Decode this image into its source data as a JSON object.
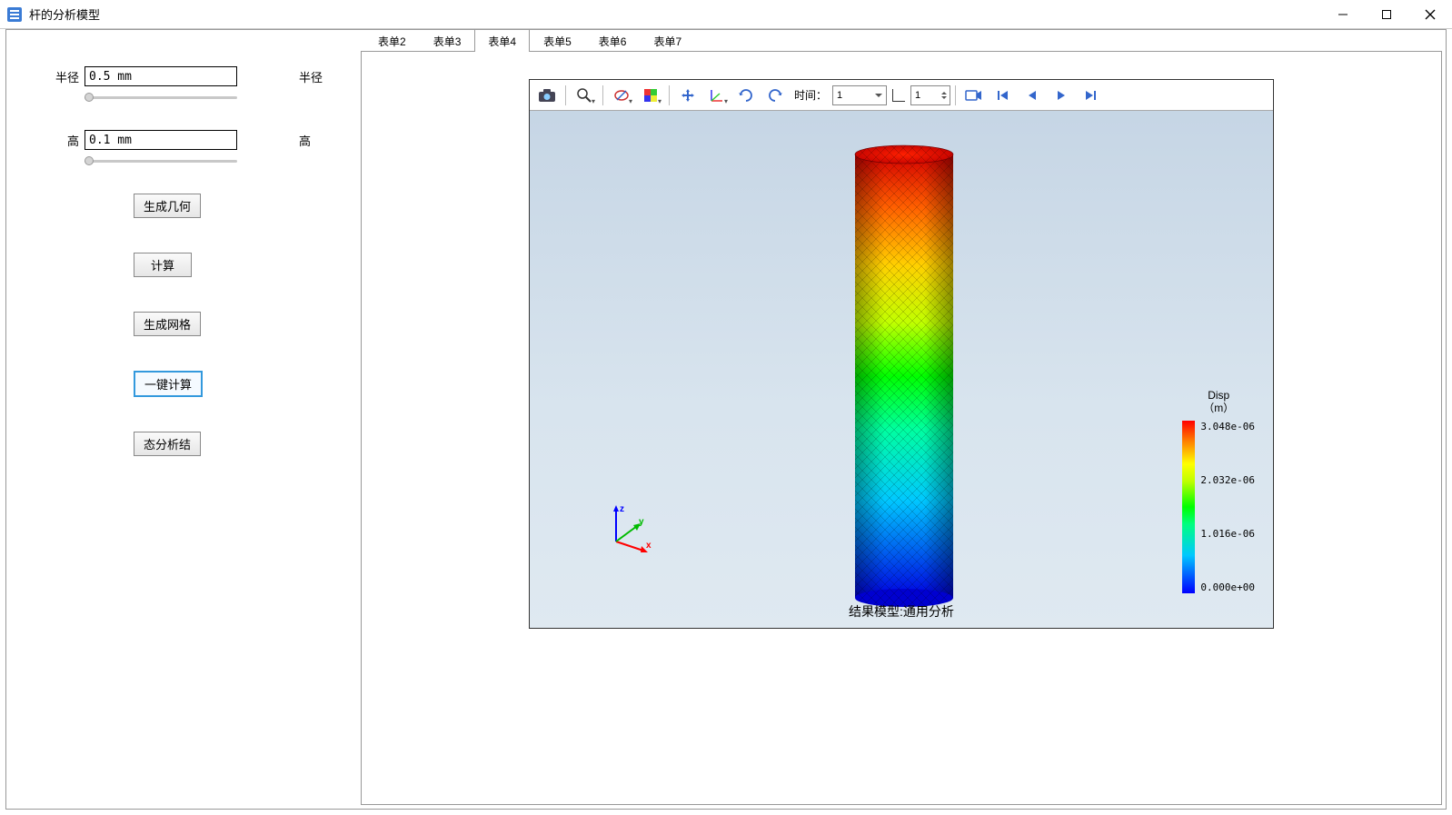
{
  "window": {
    "title": "杆的分析模型"
  },
  "sidebar": {
    "radius_label": "半径",
    "radius_value": "0.5 mm",
    "radius_label_right": "半径",
    "height_label": "高",
    "height_value": "0.1 mm",
    "height_label_right": "高",
    "buttons": {
      "gen_geom": "生成几何",
      "compute": "计算",
      "gen_mesh": "生成网格",
      "one_click": "一键计算",
      "modal_result": "态分析结"
    }
  },
  "tabs": [
    "表单2",
    "表单3",
    "表单4",
    "表单5",
    "表单6",
    "表单7"
  ],
  "active_tab_index": 2,
  "toolbar": {
    "time_label": "时间：",
    "time_combo_value": "1",
    "time_spin_value": "1"
  },
  "viewer": {
    "caption": "结果模型:通用分析"
  },
  "legend": {
    "title1": "Disp",
    "title2": "（m）",
    "ticks": [
      "3.048e-06",
      "2.032e-06",
      "1.016e-06",
      "0.000e+00"
    ]
  },
  "chart_data": {
    "type": "heatmap",
    "title": "Disp (m)",
    "field": "displacement magnitude",
    "geometry": "cylinder",
    "range": [
      0.0,
      3.048e-06
    ],
    "tick_values": [
      0.0,
      1.016e-06,
      2.032e-06,
      3.048e-06
    ],
    "gradient_direction": "axial_bottom_to_top",
    "colormap": "rainbow",
    "notes": "Displacement magnitude increases roughly linearly from fixed bottom (0) to free top (≈3.048e-06 m)."
  }
}
